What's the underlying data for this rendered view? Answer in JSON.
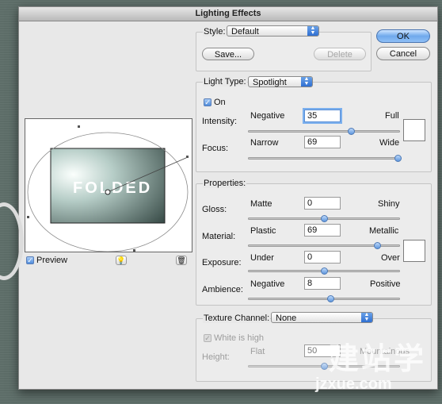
{
  "window": {
    "title": "Lighting Effects"
  },
  "style": {
    "label": "Style:",
    "value": "Default",
    "save_label": "Save...",
    "delete_label": "Delete"
  },
  "buttons": {
    "ok": "OK",
    "cancel": "Cancel"
  },
  "light_type": {
    "label": "Light Type:",
    "value": "Spotlight",
    "on_label": "On",
    "intensity": {
      "label": "Intensity:",
      "min_label": "Negative",
      "max_label": "Full",
      "value": "35",
      "fraction": 0.68
    },
    "focus": {
      "label": "Focus:",
      "min_label": "Narrow",
      "max_label": "Wide",
      "value": "69",
      "fraction": 0.99
    }
  },
  "properties": {
    "label": "Properties:",
    "gloss": {
      "label": "Gloss:",
      "min_label": "Matte",
      "max_label": "Shiny",
      "value": "0",
      "fraction": 0.5
    },
    "material": {
      "label": "Material:",
      "min_label": "Plastic",
      "max_label": "Metallic",
      "value": "69",
      "fraction": 0.85
    },
    "exposure": {
      "label": "Exposure:",
      "min_label": "Under",
      "max_label": "Over",
      "value": "0",
      "fraction": 0.5
    },
    "ambience": {
      "label": "Ambience:",
      "min_label": "Negative",
      "max_label": "Positive",
      "value": "8",
      "fraction": 0.54
    }
  },
  "texture": {
    "label": "Texture Channel:",
    "value": "None",
    "white_is_high_label": "White is high",
    "height": {
      "label": "Height:",
      "min_label": "Flat",
      "max_label": "Mountainous",
      "value": "50",
      "fraction": 0.5
    }
  },
  "preview": {
    "label": "Preview",
    "image_text": "FOLDED"
  },
  "watermark": {
    "line1": "建站学",
    "line2": "jzxue.com"
  }
}
